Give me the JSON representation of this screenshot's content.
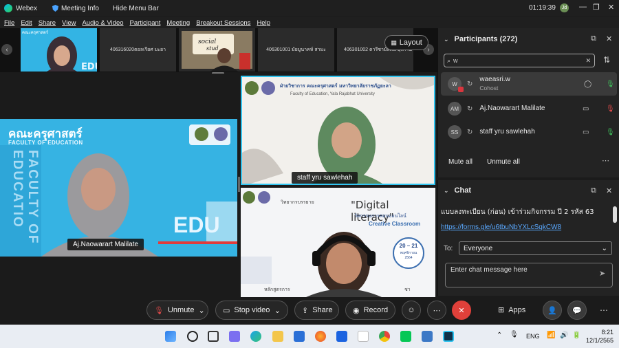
{
  "titlebar": {
    "app_name": "Webex",
    "meeting_info": "Meeting Info",
    "hide_menu": "Hide Menu Bar",
    "timer": "01:19:39",
    "user_initials": "Jd"
  },
  "menu": [
    "File",
    "Edit",
    "Share",
    "View",
    "Audio & Video",
    "Participant",
    "Meeting",
    "Breakout Sessions",
    "Help"
  ],
  "filmstrip": {
    "thumbs": [
      {
        "label": "406316020ตอลเรียศ มะยา"
      },
      {
        "label": "406301001 มัยมูนาคห์ สามะ"
      },
      {
        "label": "406301002 ดารีซามัสตัม มุงกานา"
      }
    ],
    "layout_label": "Layout"
  },
  "stage": {
    "big": {
      "name": "Aj.Naowarart Malilate",
      "thai_title": "คณะครุศาสตร์",
      "en_title": "FACULTY OF EDUCATION",
      "edu": "EDU",
      "side": "FACULTY OF EDUCATIO"
    },
    "r1": {
      "name": "staff yru sawlehah",
      "header_thai": "ฝ่ายวิชาการ คณะครุศาสตร์ มหาวิทยาลัยราชภัฏยะลา",
      "header_en": "Faculty of Education, Yala Rajabhat University"
    },
    "r2": {
      "banner_title": "\"Digital literacy\"",
      "banner_sub": "วัตกรรมการสอนออนไลน์",
      "banner_sub2": "Creative Classroom",
      "prefix": "วิทยากรบรรยาย",
      "date": "20 – 21",
      "month": "พฤศจิกายน",
      "year": "2564",
      "bottom": "หลักสูตรการ",
      "bottom_right": "ชา"
    }
  },
  "participants": {
    "title": "Participants (272)",
    "search_value": "w",
    "list": [
      {
        "initials": "W",
        "name": "waeasri.w",
        "role": "Cohost"
      },
      {
        "initials": "AM",
        "name": "Aj.Naowarart Malilate",
        "role": ""
      },
      {
        "initials": "SS",
        "name": "staff yru sawlehah",
        "role": ""
      }
    ],
    "mute_all": "Mute all",
    "unmute_all": "Unmute all"
  },
  "chat": {
    "title": "Chat",
    "message": "แบบลงทะเบียน (ก่อน) เข้าร่วมกิจกรรม ปี 2 รหัส 63",
    "link": "https://forms.gle/u6tbuNbYXLcSqkCW8",
    "to_label": "To:",
    "to_value": "Everyone",
    "placeholder": "Enter chat message here"
  },
  "toolbar": {
    "unmute": "Unmute",
    "stop_video": "Stop video",
    "share": "Share",
    "record": "Record",
    "apps": "Apps"
  },
  "taskbar": {
    "lang": "ENG",
    "time": "8:21",
    "date": "12/1/2565"
  }
}
